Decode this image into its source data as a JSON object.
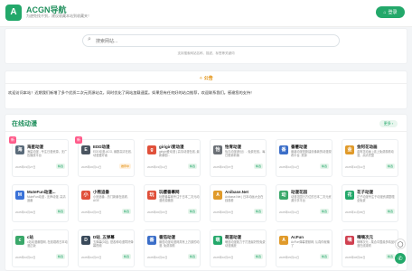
{
  "header": {
    "title": "ACGN导航",
    "subtitle": "为避免找不到，建议收藏本站到收藏夹！",
    "logo_icon": "logo-icon",
    "login_label": "登录"
  },
  "search": {
    "placeholder": "搜索网站...",
    "tip": "支持搜索网站名称、描述、标签等关键词"
  },
  "notice": {
    "title": "公告",
    "text": "欢迎访问本站！近期我们新增了多个优质二次元资源站点，同时优化了网站加载速度。如果您有任何好的站点推荐，欢迎联系我们。感谢您的支持！"
  },
  "section": {
    "title": "在线动漫",
    "more_label": "更多"
  },
  "cards": [
    {
      "name": "海星动漫",
      "desc": "海星动漫 - 专注日漫资源，无广告播放平台",
      "date": "2025年03月27日",
      "tag": "精选",
      "tag_alt": false,
      "icon": "海",
      "color": "#5a6b7a",
      "badge": true
    },
    {
      "name": "EDD动漫",
      "desc": "EDD动漫-ACG, 番剧高清在线, 动漫爱好者",
      "date": "2025年06月11日",
      "tag": "推荐中",
      "tag_alt": true,
      "icon": "E",
      "color": "#4a5560",
      "badge": true
    },
    {
      "name": "girigiri爱动漫",
      "desc": "girigiri爱动漫 | 高清动漫在线, 最新番剧...",
      "date": "2025年03月11日",
      "tag": "精选",
      "tag_alt": false,
      "icon": "g",
      "color": "#e0503a",
      "badge": false
    },
    {
      "name": "怡青动漫",
      "desc": "怡青动漫(粉丝）- 免费在线，每日更新新番",
      "date": "2025年03月07日",
      "tag": "精选",
      "tag_alt": false,
      "icon": "怡",
      "color": "#6b7076",
      "badge": false
    },
    {
      "name": "番薯动漫",
      "desc": "番薯动漫是新建设番薯的动漫观看平台, 资源",
      "date": "2025年02月11日",
      "tag": "精选",
      "tag_alt": false,
      "icon": "番",
      "color": "#3b6ec8",
      "badge": false
    },
    {
      "name": "金阿花动画",
      "desc": "金阿花动画 | 线上免费观看动漫，高清完整",
      "date": "2025年10月12日",
      "tag": "精选",
      "tag_alt": false,
      "icon": "金",
      "color": "#e09a2a",
      "badge": false
    },
    {
      "name": "MuteFun动漫...",
      "desc": "MuteFun动漫 - 无声动漫, 高清追番",
      "date": "2025年04月09日",
      "tag": "精选",
      "tag_alt": false,
      "icon": "M",
      "color": "#3a72d8",
      "badge": false
    },
    {
      "name": "小熊追番",
      "desc": "小熊追番 - 热门新番在线看, AGE",
      "date": "2025年02月15日",
      "tag": "精选",
      "tag_alt": false,
      "icon": "小",
      "color": "#e0503a",
      "badge": false
    },
    {
      "name": "玩樱番幕网",
      "desc": "玩樱番幕网专注于日本二次元动漫资源播放",
      "date": "2025年06月15日",
      "tag": "精选",
      "tag_alt": false,
      "icon": "玩",
      "color": "#e0503a",
      "badge": false
    },
    {
      "name": "Anibase.Net",
      "desc": "Anibase.Net | 日本动画大全在线观看",
      "date": "2025年06月15日",
      "tag": "精选",
      "tag_alt": false,
      "icon": "A",
      "color": "#e09a2a",
      "badge": false
    },
    {
      "name": "动漫花园",
      "desc": "动漫花园行方位的日本二次元资源分享平台",
      "date": "2025年02月11日",
      "tag": "精选",
      "tag_alt": false,
      "icon": "动",
      "color": "#3aa86a",
      "badge": false
    },
    {
      "name": "花子动漫",
      "desc": "花子动漫专注于动漫资源整理, 全免费",
      "date": "2025年11月05日",
      "tag": "精选",
      "tag_alt": false,
      "icon": "花",
      "color": "#23a86a",
      "badge": false
    },
    {
      "name": "c站",
      "desc": "c站动漫番剧网, 在线观看日本动漫正版",
      "date": "2025年02月10日",
      "tag": "精选",
      "tag_alt": false,
      "icon": "c",
      "color": "#3aa86a",
      "badge": false
    },
    {
      "name": "D站_五弹幕",
      "desc": "五弹幕(D站), 是各种动漫同好弹幕视频",
      "date": "2025年02月15日",
      "tag": "精选",
      "tag_alt": false,
      "icon": "D",
      "color": "#3a4a5a",
      "badge": false
    },
    {
      "name": "番茄动漫",
      "desc": "番茄动漫动漫网具有上万部的动漫, 免费观看",
      "date": "2025年02月01日",
      "tag": "精选",
      "tag_alt": false,
      "icon": "番",
      "color": "#3b6ec8",
      "badge": false
    },
    {
      "name": "萌道动漫",
      "desc": "萌道动漫致力于打造最好的免费动漫播放",
      "date": "2025年02月15日",
      "tag": "精选",
      "tag_alt": false,
      "icon": "萌",
      "color": "#23a86a",
      "badge": false
    },
    {
      "name": "AcFun",
      "desc": "AcFun弹幕视频网, 认真你就输了",
      "date": "2025年05月11日",
      "tag": "精选",
      "tag_alt": false,
      "icon": "A",
      "color": "#e09a2a",
      "badge": false
    },
    {
      "name": "嘀嘀次元",
      "desc": "嘀嘀次元 - 集合中国最多精品动漫在线观看",
      "date": "2025年08月02日",
      "tag": "精选",
      "tag_alt": false,
      "icon": "嘀",
      "color": "#d04050",
      "badge": false
    }
  ],
  "floats": {
    "chat_icon": "chat-icon",
    "top_icon": "arrow-up-icon"
  },
  "colors": {
    "brand": "#23a86a",
    "accent": "#e08a00"
  }
}
